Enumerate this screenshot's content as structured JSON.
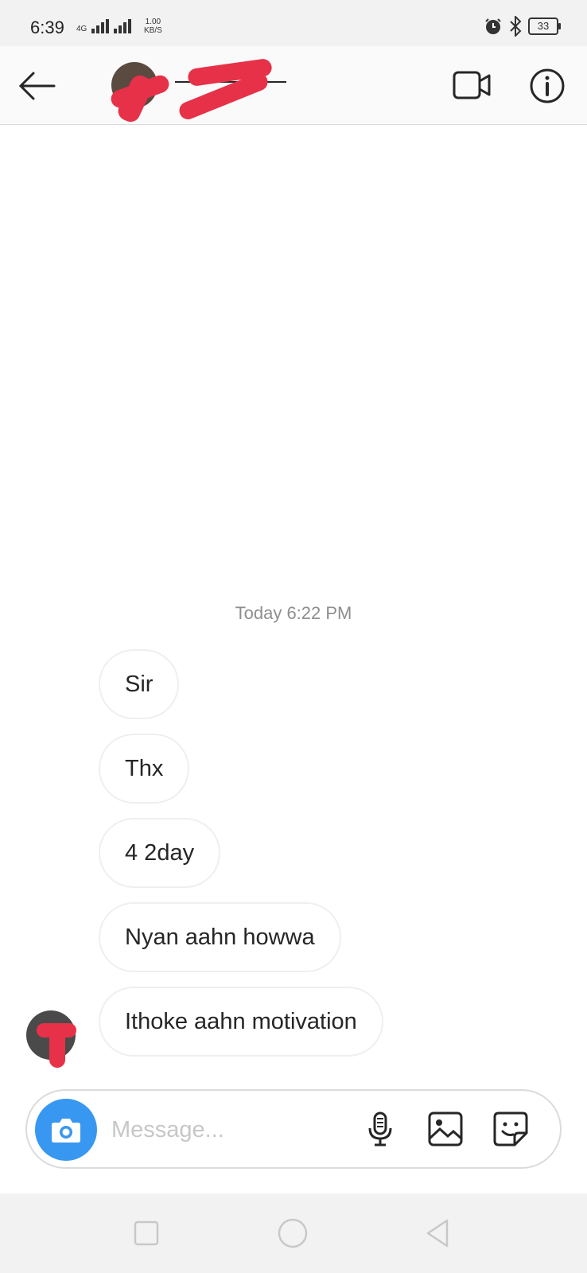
{
  "status_bar": {
    "time": "6:39",
    "network_label": "4G",
    "speed_value": "1.00",
    "speed_unit": "KB/S",
    "battery": "33"
  },
  "header": {
    "icons": [
      "back-arrow-icon",
      "video-camera-icon",
      "info-icon"
    ]
  },
  "thread": {
    "timestamp": "Today 6:22 PM",
    "messages": [
      {
        "text": "Sir"
      },
      {
        "text": "Thx"
      },
      {
        "text": "4 2day"
      },
      {
        "text": "Nyan aahn howwa"
      },
      {
        "text": "Ithoke aahn motivation"
      }
    ]
  },
  "composer": {
    "placeholder": "Message...",
    "icons": [
      "camera-icon",
      "microphone-icon",
      "gallery-icon",
      "sticker-icon"
    ]
  },
  "colors": {
    "accent": "#3897f0",
    "redaction": "#e63148",
    "bubble_border": "#efefef",
    "timestamp_text": "#8e8e8e"
  }
}
